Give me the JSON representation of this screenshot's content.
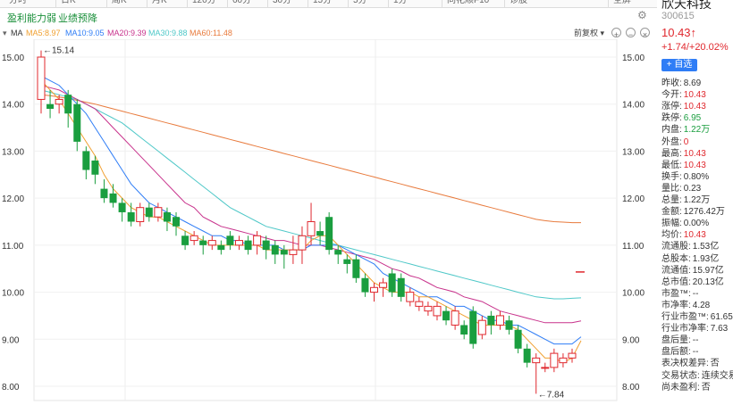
{
  "tabs": [
    "分时",
    "日K",
    "周K",
    "月K",
    "120分",
    "60分",
    "30分",
    "15分",
    "5分",
    "1分",
    "同花顺F10",
    "诊股",
    "全屏"
  ],
  "toolbar": {
    "link1": "盈利能力弱",
    "link2": "业绩预降"
  },
  "ma": {
    "label": "MA",
    "ma5": "MA5:8.97",
    "ma10": "MA10:9.05",
    "ma20": "MA20:9.39",
    "ma30": "MA30:9.88",
    "ma60": "MA60:11.48",
    "fq": "前复权 ▾",
    "colors": {
      "ma5": "#f0a030",
      "ma10": "#2f7df6",
      "ma20": "#c8328c",
      "ma30": "#4fc8c8",
      "ma60": "#e87a3c"
    }
  },
  "quote": {
    "name": "欣天科技",
    "code": "300615",
    "price": "10.43↑",
    "change": "+1.74/+20.02%",
    "add_label": "+ 自选",
    "rows": [
      {
        "k": "昨收:",
        "v": "8.69",
        "c": "n"
      },
      {
        "k": "今开:",
        "v": "10.43",
        "c": "r"
      },
      {
        "k": "涨停:",
        "v": "10.43",
        "c": "r"
      },
      {
        "k": "跌停:",
        "v": "6.95",
        "c": "g"
      },
      {
        "k": "内盘:",
        "v": "1.22万",
        "c": "g"
      },
      {
        "k": "外盘:",
        "v": "0",
        "c": "r"
      },
      {
        "k": "最高:",
        "v": "10.43",
        "c": "r"
      },
      {
        "k": "最低:",
        "v": "10.43",
        "c": "r"
      },
      {
        "k": "换手:",
        "v": "0.80%",
        "c": "n"
      },
      {
        "k": "量比:",
        "v": "0.23",
        "c": "n"
      },
      {
        "k": "总量:",
        "v": "1.22万",
        "c": "n"
      },
      {
        "k": "金额:",
        "v": "1276.42万",
        "c": "n"
      },
      {
        "k": "振幅:",
        "v": "0.00%",
        "c": "n"
      },
      {
        "k": "均价:",
        "v": "10.43",
        "c": "r"
      },
      {
        "k": "流通股:",
        "v": "1.53亿",
        "c": "n"
      },
      {
        "k": "总股本:",
        "v": "1.93亿",
        "c": "n"
      },
      {
        "k": "流通值:",
        "v": "15.97亿",
        "c": "n"
      },
      {
        "k": "总市值:",
        "v": "20.13亿",
        "c": "n"
      },
      {
        "k": "市盈™:",
        "v": "--",
        "c": "n"
      },
      {
        "k": "市净率:",
        "v": "4.28",
        "c": "n"
      },
      {
        "k": "行业市盈™:",
        "v": "61.65",
        "c": "n"
      },
      {
        "k": "行业市净率:",
        "v": "7.63",
        "c": "n"
      },
      {
        "k": "盘后量:",
        "v": "--",
        "c": "n"
      },
      {
        "k": "盘后额:",
        "v": "--",
        "c": "n"
      },
      {
        "k": "表决权差异:",
        "v": "否",
        "c": "n"
      },
      {
        "k": "交易状态:",
        "v": "连续交易",
        "c": "n"
      },
      {
        "k": "尚未盈利:",
        "v": "否",
        "c": "n"
      }
    ]
  },
  "chart_data": {
    "type": "candlestick",
    "ylim": [
      7.8,
      15.2
    ],
    "y_ticks": [
      8.0,
      9.0,
      10.0,
      11.0,
      12.0,
      13.0,
      14.0,
      15.0
    ],
    "high_label": "←15.14",
    "low_label": "←7.84",
    "candles": [
      [
        14.1,
        15.0,
        15.14,
        13.8
      ],
      [
        14.0,
        13.9,
        14.3,
        13.7
      ],
      [
        14.0,
        14.1,
        14.2,
        13.8
      ],
      [
        14.2,
        13.8,
        14.3,
        13.5
      ],
      [
        14.0,
        13.2,
        14.1,
        13.0
      ],
      [
        13.0,
        12.6,
        13.1,
        12.4
      ],
      [
        12.8,
        12.5,
        12.9,
        12.3
      ],
      [
        12.2,
        12.0,
        12.4,
        11.9
      ],
      [
        12.1,
        11.9,
        12.3,
        11.8
      ],
      [
        11.9,
        11.7,
        12.0,
        11.5
      ],
      [
        11.7,
        11.5,
        11.9,
        11.4
      ],
      [
        11.5,
        11.8,
        11.9,
        11.4
      ],
      [
        11.8,
        11.6,
        11.9,
        11.5
      ],
      [
        11.6,
        11.8,
        11.9,
        11.5
      ],
      [
        11.7,
        11.5,
        11.8,
        11.3
      ],
      [
        11.6,
        11.4,
        11.7,
        11.2
      ],
      [
        11.2,
        11.0,
        11.3,
        10.9
      ],
      [
        11.1,
        11.2,
        11.3,
        11.0
      ],
      [
        11.1,
        11.0,
        11.2,
        10.8
      ],
      [
        11.0,
        11.1,
        11.2,
        10.9
      ],
      [
        11.0,
        10.9,
        11.1,
        10.8
      ],
      [
        11.2,
        11.0,
        11.3,
        10.9
      ],
      [
        11.0,
        11.1,
        11.2,
        10.9
      ],
      [
        11.1,
        10.9,
        11.2,
        10.8
      ],
      [
        11.0,
        11.2,
        11.3,
        10.8
      ],
      [
        11.1,
        10.9,
        11.2,
        10.7
      ],
      [
        11.0,
        10.8,
        11.1,
        10.6
      ],
      [
        10.9,
        10.8,
        11.0,
        10.5
      ],
      [
        10.8,
        10.9,
        11.2,
        10.6
      ],
      [
        10.9,
        11.2,
        11.4,
        10.6
      ],
      [
        11.2,
        11.5,
        11.9,
        11.0
      ],
      [
        11.3,
        11.2,
        11.5,
        11.0
      ],
      [
        11.6,
        10.9,
        11.7,
        10.8
      ],
      [
        10.9,
        10.8,
        11.0,
        10.6
      ],
      [
        10.7,
        10.6,
        10.8,
        10.4
      ],
      [
        10.7,
        10.3,
        10.8,
        10.2
      ],
      [
        10.3,
        10.0,
        10.4,
        9.9
      ],
      [
        10.0,
        10.1,
        10.2,
        9.8
      ],
      [
        10.1,
        10.2,
        10.3,
        9.9
      ],
      [
        10.4,
        10.0,
        10.5,
        9.9
      ],
      [
        10.3,
        9.9,
        10.4,
        9.8
      ],
      [
        9.8,
        10.0,
        10.1,
        9.7
      ],
      [
        9.7,
        9.8,
        9.9,
        9.6
      ],
      [
        9.6,
        9.7,
        9.8,
        9.5
      ],
      [
        9.5,
        9.7,
        9.8,
        9.4
      ],
      [
        9.6,
        9.4,
        9.7,
        9.3
      ],
      [
        9.3,
        9.6,
        9.7,
        9.2
      ],
      [
        9.3,
        9.1,
        9.4,
        9.0
      ],
      [
        9.6,
        8.9,
        9.7,
        8.8
      ],
      [
        9.1,
        9.4,
        9.5,
        9.0
      ],
      [
        9.5,
        9.3,
        9.6,
        9.1
      ],
      [
        9.3,
        9.5,
        9.6,
        9.2
      ],
      [
        9.4,
        9.2,
        9.5,
        9.1
      ],
      [
        9.2,
        8.8,
        9.3,
        8.7
      ],
      [
        8.8,
        8.5,
        8.9,
        8.4
      ],
      [
        8.5,
        8.6,
        8.7,
        7.84
      ],
      [
        8.4,
        8.4,
        8.5,
        8.3
      ],
      [
        8.4,
        8.7,
        8.8,
        8.3
      ],
      [
        8.5,
        8.6,
        8.7,
        8.4
      ],
      [
        8.6,
        8.7,
        8.8,
        8.5
      ],
      [
        10.43,
        10.43,
        10.43,
        10.43
      ]
    ],
    "ma5": [
      14.5,
      14.3,
      14.1,
      13.8,
      13.5,
      13.2,
      12.9,
      12.5,
      12.2,
      12.0,
      11.8,
      11.7,
      11.6,
      11.6,
      11.5,
      11.4,
      11.3,
      11.2,
      11.1,
      11.0,
      11.0,
      11.0,
      11.0,
      11.0,
      11.0,
      10.9,
      10.9,
      10.9,
      10.9,
      10.9,
      11.1,
      11.2,
      11.2,
      11.0,
      10.8,
      10.6,
      10.4,
      10.2,
      10.1,
      10.0,
      10.0,
      10.0,
      9.9,
      9.9,
      9.8,
      9.7,
      9.6,
      9.5,
      9.4,
      9.3,
      9.3,
      9.3,
      9.3,
      9.2,
      9.0,
      8.8,
      8.6,
      8.6,
      8.5,
      8.6,
      8.97
    ],
    "ma10": [
      14.6,
      14.5,
      14.4,
      14.2,
      14.0,
      13.8,
      13.5,
      13.2,
      12.9,
      12.6,
      12.3,
      12.1,
      11.9,
      11.8,
      11.7,
      11.6,
      11.5,
      11.4,
      11.3,
      11.2,
      11.2,
      11.1,
      11.1,
      11.0,
      11.0,
      11.0,
      11.0,
      10.9,
      10.9,
      10.9,
      11.0,
      11.0,
      11.0,
      11.0,
      10.9,
      10.8,
      10.7,
      10.6,
      10.4,
      10.3,
      10.2,
      10.1,
      10.0,
      9.9,
      9.9,
      9.8,
      9.7,
      9.7,
      9.6,
      9.5,
      9.4,
      9.4,
      9.3,
      9.3,
      9.2,
      9.1,
      9.0,
      8.9,
      8.9,
      8.9,
      9.05
    ],
    "ma20": [
      14.4,
      14.35,
      14.3,
      14.2,
      14.1,
      14.0,
      13.9,
      13.7,
      13.5,
      13.3,
      13.1,
      12.9,
      12.7,
      12.5,
      12.3,
      12.1,
      11.9,
      11.8,
      11.6,
      11.5,
      11.4,
      11.35,
      11.3,
      11.25,
      11.2,
      11.15,
      11.1,
      11.1,
      11.05,
      11.0,
      11.0,
      11.0,
      10.95,
      10.9,
      10.85,
      10.8,
      10.75,
      10.7,
      10.6,
      10.5,
      10.45,
      10.35,
      10.3,
      10.2,
      10.1,
      10.05,
      10.0,
      9.9,
      9.85,
      9.8,
      9.7,
      9.6,
      9.55,
      9.5,
      9.45,
      9.4,
      9.35,
      9.35,
      9.35,
      9.35,
      9.39
    ],
    "ma30": [
      14.3,
      14.25,
      14.2,
      14.15,
      14.1,
      14.0,
      13.9,
      13.8,
      13.7,
      13.6,
      13.45,
      13.3,
      13.15,
      13.0,
      12.85,
      12.7,
      12.55,
      12.4,
      12.25,
      12.1,
      11.95,
      11.8,
      11.7,
      11.6,
      11.5,
      11.4,
      11.35,
      11.3,
      11.25,
      11.2,
      11.15,
      11.1,
      11.05,
      11.0,
      10.95,
      10.9,
      10.85,
      10.8,
      10.75,
      10.7,
      10.65,
      10.6,
      10.55,
      10.5,
      10.45,
      10.4,
      10.35,
      10.3,
      10.25,
      10.2,
      10.15,
      10.1,
      10.05,
      10.0,
      9.95,
      9.9,
      9.88,
      9.86,
      9.86,
      9.87,
      9.88
    ],
    "ma60": [
      14.2,
      14.18,
      14.15,
      14.12,
      14.08,
      14.04,
      14.0,
      13.95,
      13.9,
      13.85,
      13.8,
      13.75,
      13.7,
      13.65,
      13.6,
      13.55,
      13.5,
      13.45,
      13.4,
      13.35,
      13.3,
      13.25,
      13.2,
      13.15,
      13.1,
      13.05,
      13.0,
      12.95,
      12.9,
      12.85,
      12.8,
      12.75,
      12.7,
      12.65,
      12.6,
      12.55,
      12.5,
      12.45,
      12.4,
      12.35,
      12.3,
      12.25,
      12.2,
      12.15,
      12.1,
      12.05,
      12.0,
      11.95,
      11.9,
      11.85,
      11.8,
      11.75,
      11.7,
      11.65,
      11.6,
      11.55,
      11.52,
      11.5,
      11.49,
      11.48,
      11.48
    ]
  }
}
